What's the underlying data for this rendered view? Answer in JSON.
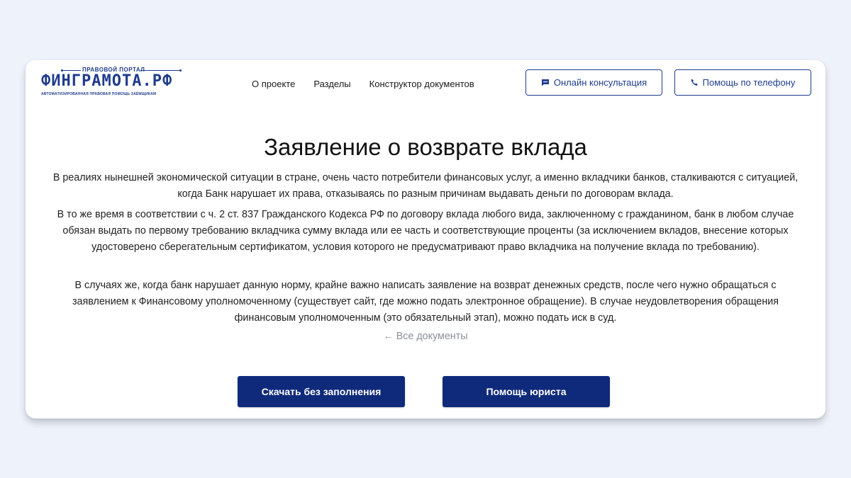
{
  "logo": {
    "top_text": "ПРАВОВОЙ ПОРТАЛ",
    "main_text": "ФИНГРАМОТА.РФ",
    "bottom_text": "АВТОМАТИЗИРОВАННАЯ ПРАВОВАЯ ПОМОЩЬ ЗАЁМЩИКАМ"
  },
  "nav": {
    "items": [
      "О проекте",
      "Разделы",
      "Конструктор документов"
    ]
  },
  "header_buttons": {
    "online": "Онлайн консультация",
    "phone": "Помощь по телефону"
  },
  "article": {
    "title": "Заявление о возврате вклада",
    "paragraphs": [
      "В реалиях нынешней экономической ситуации в стране, очень часто потребители финансовых услуг, а именно вкладчики банков, сталкиваются с ситуацией, когда Банк нарушает их права, отказываясь по разным причинам выдавать деньги по договорам вклада.",
      "В то же время в соответствии с ч. 2 ст. 837 Гражданского Кодекса РФ по договору вклада любого вида, заключенному с гражданином, банк в любом случае обязан выдать по первому требованию вкладчика сумму вклада или ее часть и соответствующие проценты (за исключением вкладов, внесение которых удостоверено сберегательным сертификатом, условия которого не предусматривают право вкладчика на получение вклада по требованию).",
      "В случаях же, когда банк нарушает данную норму, крайне важно написать заявление на возврат денежных средств, после чего нужно обращаться с заявлением к Финансовому уполномоченному (существует сайт, где можно подать электронное обращение). В случае неудовлетворения обращения финансовым уполномоченным (это обязательный этап), можно подать иск в суд."
    ],
    "all_docs": "← Все документы"
  },
  "actions": {
    "download": "Скачать без заполнения",
    "lawyer": "Помощь юриста"
  },
  "colors": {
    "brand": "#0f2a7a",
    "page_bg": "#eef2fb"
  }
}
